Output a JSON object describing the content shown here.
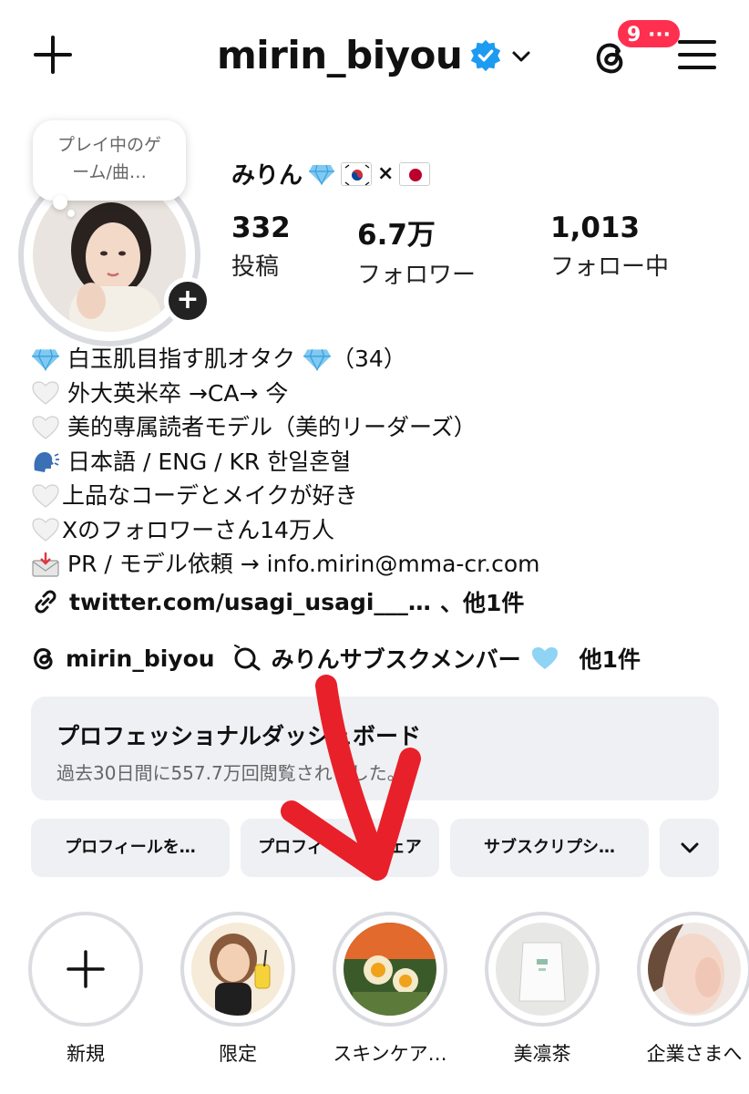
{
  "header": {
    "username": "mirin_biyou",
    "notification_count": "9 ···"
  },
  "profile": {
    "note": "プレイ中のゲーム/曲…",
    "display_name": "みりん",
    "times_sign": "×",
    "stats": [
      {
        "value": "332",
        "label": "投稿"
      },
      {
        "value": "6.7万",
        "label": "フォロワー"
      },
      {
        "value": "1,013",
        "label": "フォロー中"
      }
    ]
  },
  "bio": {
    "lines": [
      "白玉肌目指す肌オタク",
      "（34）",
      "外大英米卒 →CA→ 今",
      "美的専属読者モデル（美的リーダーズ）",
      "日本語 / ENG / KR 한일혼혈",
      "上品なコーデとメイクが好き",
      "Xのフォロワーさん14万人",
      "PR / モデル依頼 → info.mirin@mma-cr.com"
    ],
    "link": "twitter.com/usagi_usagi___…",
    "link_more": "、他1件",
    "threads_handle": "mirin_biyou",
    "channel": "みりんサブスクメンバー",
    "channel_more": "他1件"
  },
  "dashboard": {
    "title": "プロフェッショナルダッシュボード",
    "subtitle": "過去30日間に557.7万回閲覧されました。"
  },
  "buttons": {
    "edit_profile": "プロフィールを…",
    "share_profile": "プロフィールをシェア",
    "subscription": "サブスクリプシ…"
  },
  "highlights": [
    {
      "label": "新規"
    },
    {
      "label": "限定"
    },
    {
      "label": "スキンケア…"
    },
    {
      "label": "美凛茶"
    },
    {
      "label": "企業さまへ"
    }
  ],
  "colors": {
    "verified": "#1d9bf0",
    "badge": "#ff2f4f",
    "arrow": "#e8202a",
    "button_bg": "#eff0f3"
  }
}
